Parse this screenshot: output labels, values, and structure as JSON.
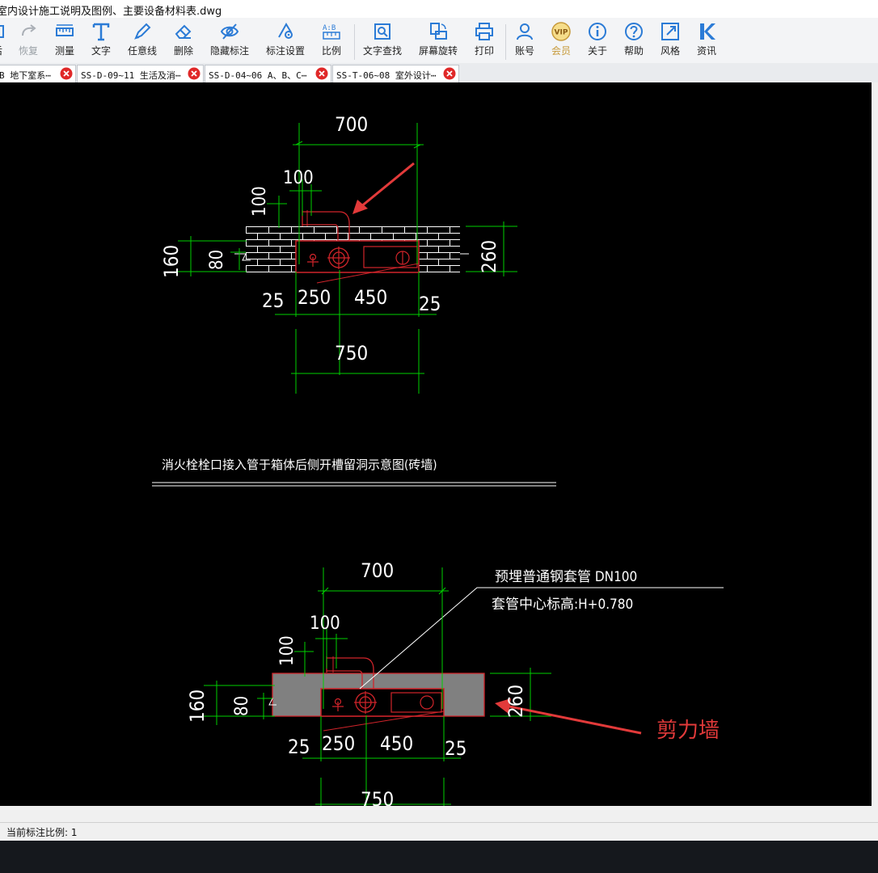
{
  "window": {
    "title": "室内设计施工说明及图例、主要设备材料表.dwg"
  },
  "toolbar": {
    "first_label": "后",
    "redo_label": "恢复",
    "measure_label": "测量",
    "text_label": "文字",
    "freeline_label": "任意线",
    "delete_label": "删除",
    "hide_annotation_label": "隐藏标注",
    "annotation_settings_label": "标注设置",
    "scale_label": "比例",
    "text_search_label": "文字查找",
    "screen_rotate_label": "屏幕旋转",
    "print_label": "打印",
    "account_label": "账号",
    "vip_label": "会员",
    "about_label": "关于",
    "help_label": "帮助",
    "style_label": "风格",
    "news_label": "资讯"
  },
  "tabs": [
    {
      "label": "B 地下室系⋯"
    },
    {
      "label": "SS-D-09~11 生活及消⋯"
    },
    {
      "label": "SS-D-04~06 A、B、C⋯"
    },
    {
      "label": "SS-T-06~08 室外设计⋯"
    }
  ],
  "drawing": {
    "top": {
      "dim_700": "700",
      "dim_100_h": "100",
      "dim_100_v": "100",
      "dim_160": "160",
      "dim_80": "80",
      "dim_260": "260",
      "dim_25_left": "25",
      "dim_250": "250",
      "dim_450": "450",
      "dim_25_right": "25",
      "dim_750": "750"
    },
    "caption": "消火栓栓口接入管于箱体后侧开槽留洞示意图(砖墙)",
    "bottom": {
      "dim_700": "700",
      "dim_100_h": "100",
      "dim_100_v": "100",
      "dim_160": "160",
      "dim_80": "80",
      "dim_260": "260",
      "dim_25_left": "25",
      "dim_250": "250",
      "dim_450": "450",
      "dim_25_right": "25",
      "dim_750": "750",
      "note_line1": "预埋普通钢套管 DN100",
      "note_line2": "套管中心标高:H+0.780",
      "shear_wall_label": "剪力墙"
    }
  },
  "status": {
    "text": "当前标注比例: 1"
  },
  "colors": {
    "cad_green": "#00d000",
    "cad_red": "#d0242a",
    "annotation_red": "#e23a3a",
    "toolbar_blue": "#2b7bd6"
  }
}
